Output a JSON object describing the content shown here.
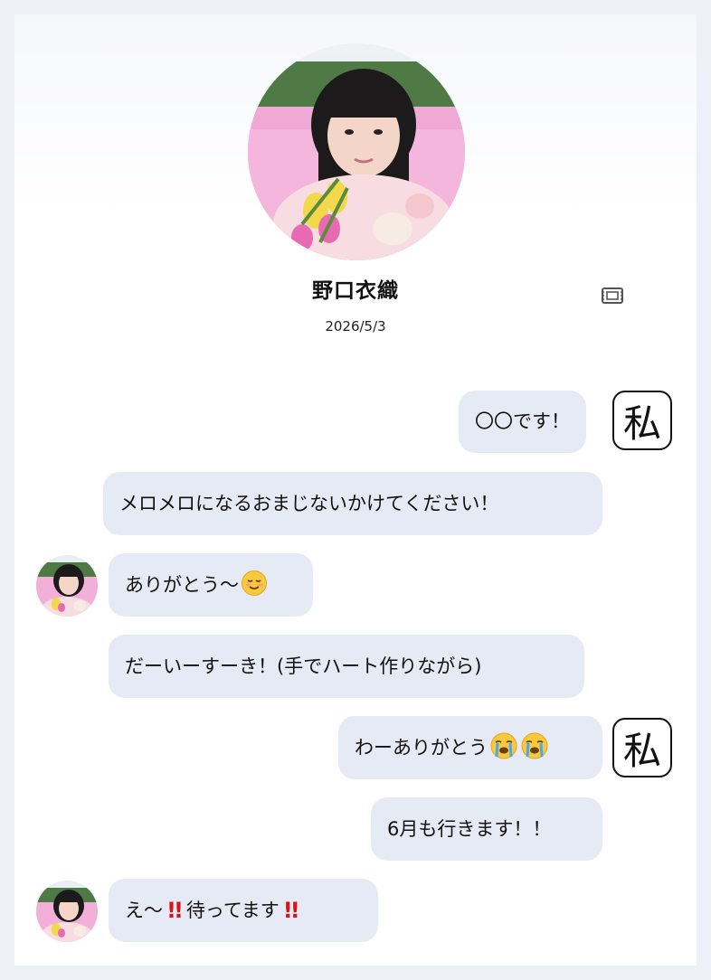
{
  "profile": {
    "name": "野口衣織",
    "date": "2026/5/3"
  },
  "me_tag": "私",
  "messages": [
    {
      "from": "me",
      "text": "〇〇です！"
    },
    {
      "from": "me",
      "text": "メロメロになるおまじないかけてください！"
    },
    {
      "from": "her",
      "text": "ありがとう〜"
    },
    {
      "from": "her",
      "text": "だーいーすーき！(手でハート作りながら)"
    },
    {
      "from": "me",
      "text": "わーありがとう"
    },
    {
      "from": "me",
      "text": "6月も行きます！！"
    },
    {
      "from": "her",
      "text_a": "え〜",
      "text_b": "待ってます",
      "bang": "!!"
    }
  ],
  "icons": [
    "ticket-icon",
    "relieved-face-emoji",
    "crying-face-emoji",
    "double-exclamation-emoji"
  ]
}
